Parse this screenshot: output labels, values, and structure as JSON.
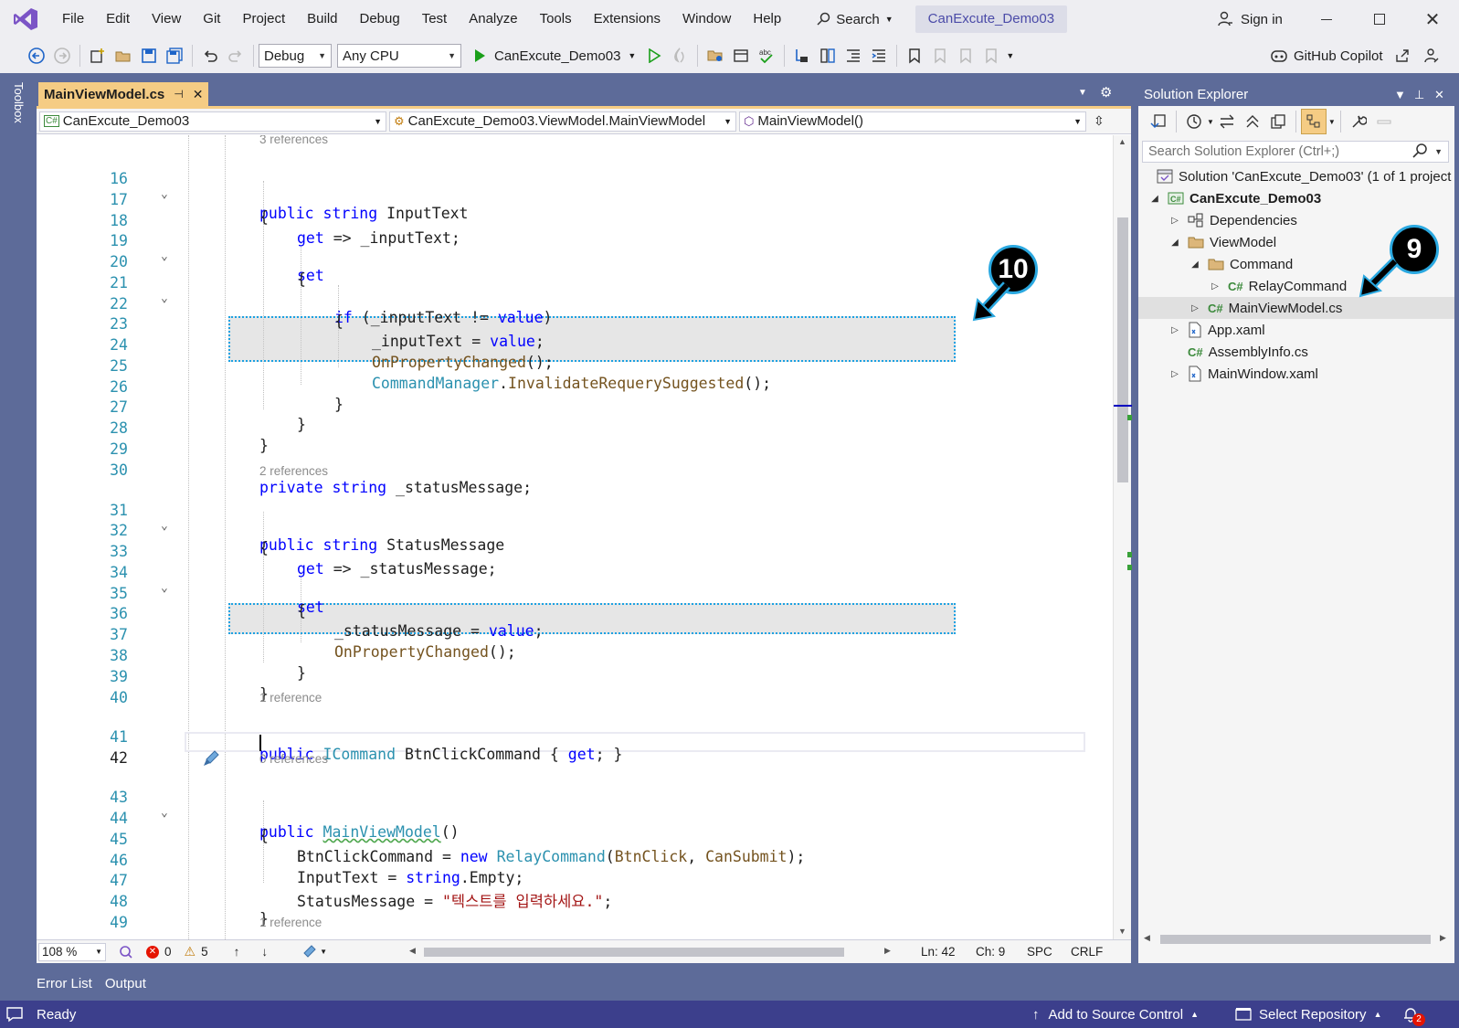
{
  "menu": {
    "items": [
      "File",
      "Edit",
      "View",
      "Git",
      "Project",
      "Build",
      "Debug",
      "Test",
      "Analyze",
      "Tools",
      "Extensions",
      "Window",
      "Help"
    ],
    "search_label": "Search",
    "project_badge": "CanExcute_Demo03",
    "signin_label": "Sign in"
  },
  "toolbar": {
    "config": "Debug",
    "platform": "Any CPU",
    "run_target": "CanExcute_Demo03",
    "copilot_label": "GitHub Copilot"
  },
  "toolbox_label": "Toolbox",
  "editor": {
    "tab_title": "MainViewModel.cs",
    "nav_project": "CanExcute_Demo03",
    "nav_class": "CanExcute_Demo03.ViewModel.MainViewModel",
    "nav_member": "MainViewModel()",
    "codelens": {
      "inputtext": "3 references",
      "statusmessage": "2 references",
      "btnclick": "1 reference",
      "ctor": "0 references",
      "next": "1 reference"
    },
    "lines": {
      "l16": "16",
      "l17": "17",
      "l18": "18",
      "l19": "19",
      "l20": "20",
      "l21": "21",
      "l22": "22",
      "l23": "23",
      "l24": "24",
      "l25": "25",
      "l26": "26",
      "l27": "27",
      "l28": "28",
      "l29": "29",
      "l30": "30",
      "l31": "31",
      "l32": "32",
      "l33": "33",
      "l34": "34",
      "l35": "35",
      "l36": "36",
      "l37": "37",
      "l38": "38",
      "l39": "39",
      "l40": "40",
      "l41": "41",
      "l42": "42",
      "l43": "43",
      "l44": "44",
      "l45": "45",
      "l46": "46",
      "l47": "47",
      "l48": "48",
      "l49": "49"
    },
    "code": {
      "c16_kw": "public",
      "c16_ty": "string",
      "c16_rest": " InputText",
      "c17": "{",
      "c18_kw": "get",
      "c18_rest": " => _inputText;",
      "c19_kw": "set",
      "c20": "{",
      "c21_kw": "if",
      "c21_a": " (_inputText != ",
      "c21_kw2": "value",
      "c21_b": ")",
      "c22": "{",
      "c23_a": "_inputText = ",
      "c23_kw": "value",
      "c23_b": ";",
      "c24_me": "OnPropertyChanged",
      "c24_b": "();",
      "c25_ty": "CommandManager",
      "c25_dot": ".",
      "c25_me": "InvalidateRequerySuggested",
      "c25_b": "();",
      "c26": "}",
      "c27": "}",
      "c28": "}",
      "c30_kw": "private",
      "c30_ty": "string",
      "c30_rest": " _statusMessage;",
      "c31_kw": "public",
      "c31_ty": "string",
      "c31_rest": " StatusMessage",
      "c32": "{",
      "c33_kw": "get",
      "c33_rest": " => _statusMessage;",
      "c34_kw": "set",
      "c35": "{",
      "c36_a": "_statusMessage = ",
      "c36_kw": "value",
      "c36_b": ";",
      "c37_me": "OnPropertyChanged",
      "c37_b": "();",
      "c38": "}",
      "c39": "}",
      "c41_kw": "public",
      "c41_ty": "ICommand",
      "c41_rest": " BtnClickCommand { ",
      "c41_kw2": "get",
      "c41_end": "; }",
      "c43_kw": "public",
      "c43_ty": "MainViewModel",
      "c43_rest": "()",
      "c44": "{",
      "c45_a": "BtnClickCommand = ",
      "c45_kw": "new",
      "c45_ty": "RelayCommand",
      "c45_b": "(",
      "c45_me1": "BtnClick",
      "c45_c": ", ",
      "c45_me2": "CanSubmit",
      "c45_d": ");",
      "c46_a": "InputText = ",
      "c46_kw": "string",
      "c46_b": ".Empty;",
      "c47_a": "StatusMessage = ",
      "c47_st": "\"텍스트를 입력하세요.\"",
      "c47_b": ";",
      "c48": "}"
    },
    "status": {
      "zoom": "108 %",
      "errors": "0",
      "warnings": "5",
      "ln": "Ln: 42",
      "ch": "Ch: 9",
      "spc": "SPC",
      "crlf": "CRLF"
    }
  },
  "bottom_tabs": [
    "Error List",
    "Output"
  ],
  "solution_explorer": {
    "title": "Solution Explorer",
    "search_placeholder": "Search Solution Explorer (Ctrl+;)",
    "solution": "Solution 'CanExcute_Demo03' (1 of 1 project",
    "project": "CanExcute_Demo03",
    "dependencies": "Dependencies",
    "viewmodel_folder": "ViewModel",
    "command_folder": "Command",
    "relaycommand": "RelayCommand",
    "mainviewmodel": "MainViewModel.cs",
    "app_xaml": "App.xaml",
    "assemblyinfo": "AssemblyInfo.cs",
    "mainwindow": "MainWindow.xaml"
  },
  "callouts": {
    "nine": "9",
    "ten": "10"
  },
  "statusbar": {
    "ready": "Ready",
    "source_control": "Add to Source Control",
    "select_repo": "Select Repository",
    "notifications": "2"
  },
  "colors": {
    "accent": "#5D6B99",
    "tab_active": "#F5CC84",
    "status_bar": "#3C3F8C",
    "callout_border": "#2AA8E0",
    "highlight_border": "#1BA1E2"
  }
}
